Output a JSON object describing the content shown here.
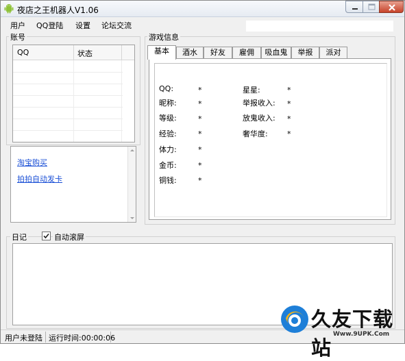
{
  "window": {
    "title": "夜店之王机器人V1.06",
    "controls": {
      "minimize": "minimize-icon",
      "maximize": "maximize-icon",
      "close": "close-icon"
    }
  },
  "menu": {
    "items": [
      "用户",
      "QQ登陆",
      "设置",
      "论坛交流"
    ]
  },
  "account": {
    "group_label": "账号",
    "columns": [
      "QQ",
      "状态"
    ]
  },
  "links": {
    "taobao": "淘宝购买",
    "paipai": "拍拍自动发卡"
  },
  "game": {
    "group_label": "游戏信息",
    "tabs": [
      "基本",
      "酒水",
      "好友",
      "雇佣",
      "吸血鬼",
      "举报",
      "派对"
    ],
    "active_tab": "基本",
    "left_fields": [
      {
        "label": "QQ:",
        "value": "*"
      },
      {
        "label": "昵称:",
        "value": "*"
      },
      {
        "label": "等级:",
        "value": "*"
      },
      {
        "label": "经验:",
        "value": "*"
      },
      {
        "label": "体力:",
        "value": "*"
      },
      {
        "label": "金币:",
        "value": "*"
      },
      {
        "label": "铜钱:",
        "value": "*"
      }
    ],
    "right_fields": [
      {
        "label": "星星:",
        "value": "*"
      },
      {
        "label": "举报收入:",
        "value": "*"
      },
      {
        "label": "放鬼收入:",
        "value": "*"
      },
      {
        "label": "奢华度:",
        "value": "*"
      }
    ]
  },
  "log": {
    "label": "日记",
    "auto_scroll_label": "自动滚屏",
    "auto_scroll_checked": true
  },
  "status": {
    "login": "用户未登陆",
    "runtime": "运行时间:00:00:06"
  },
  "watermark": {
    "text": "久友下载站",
    "url": "Www.9UPK.Com"
  }
}
